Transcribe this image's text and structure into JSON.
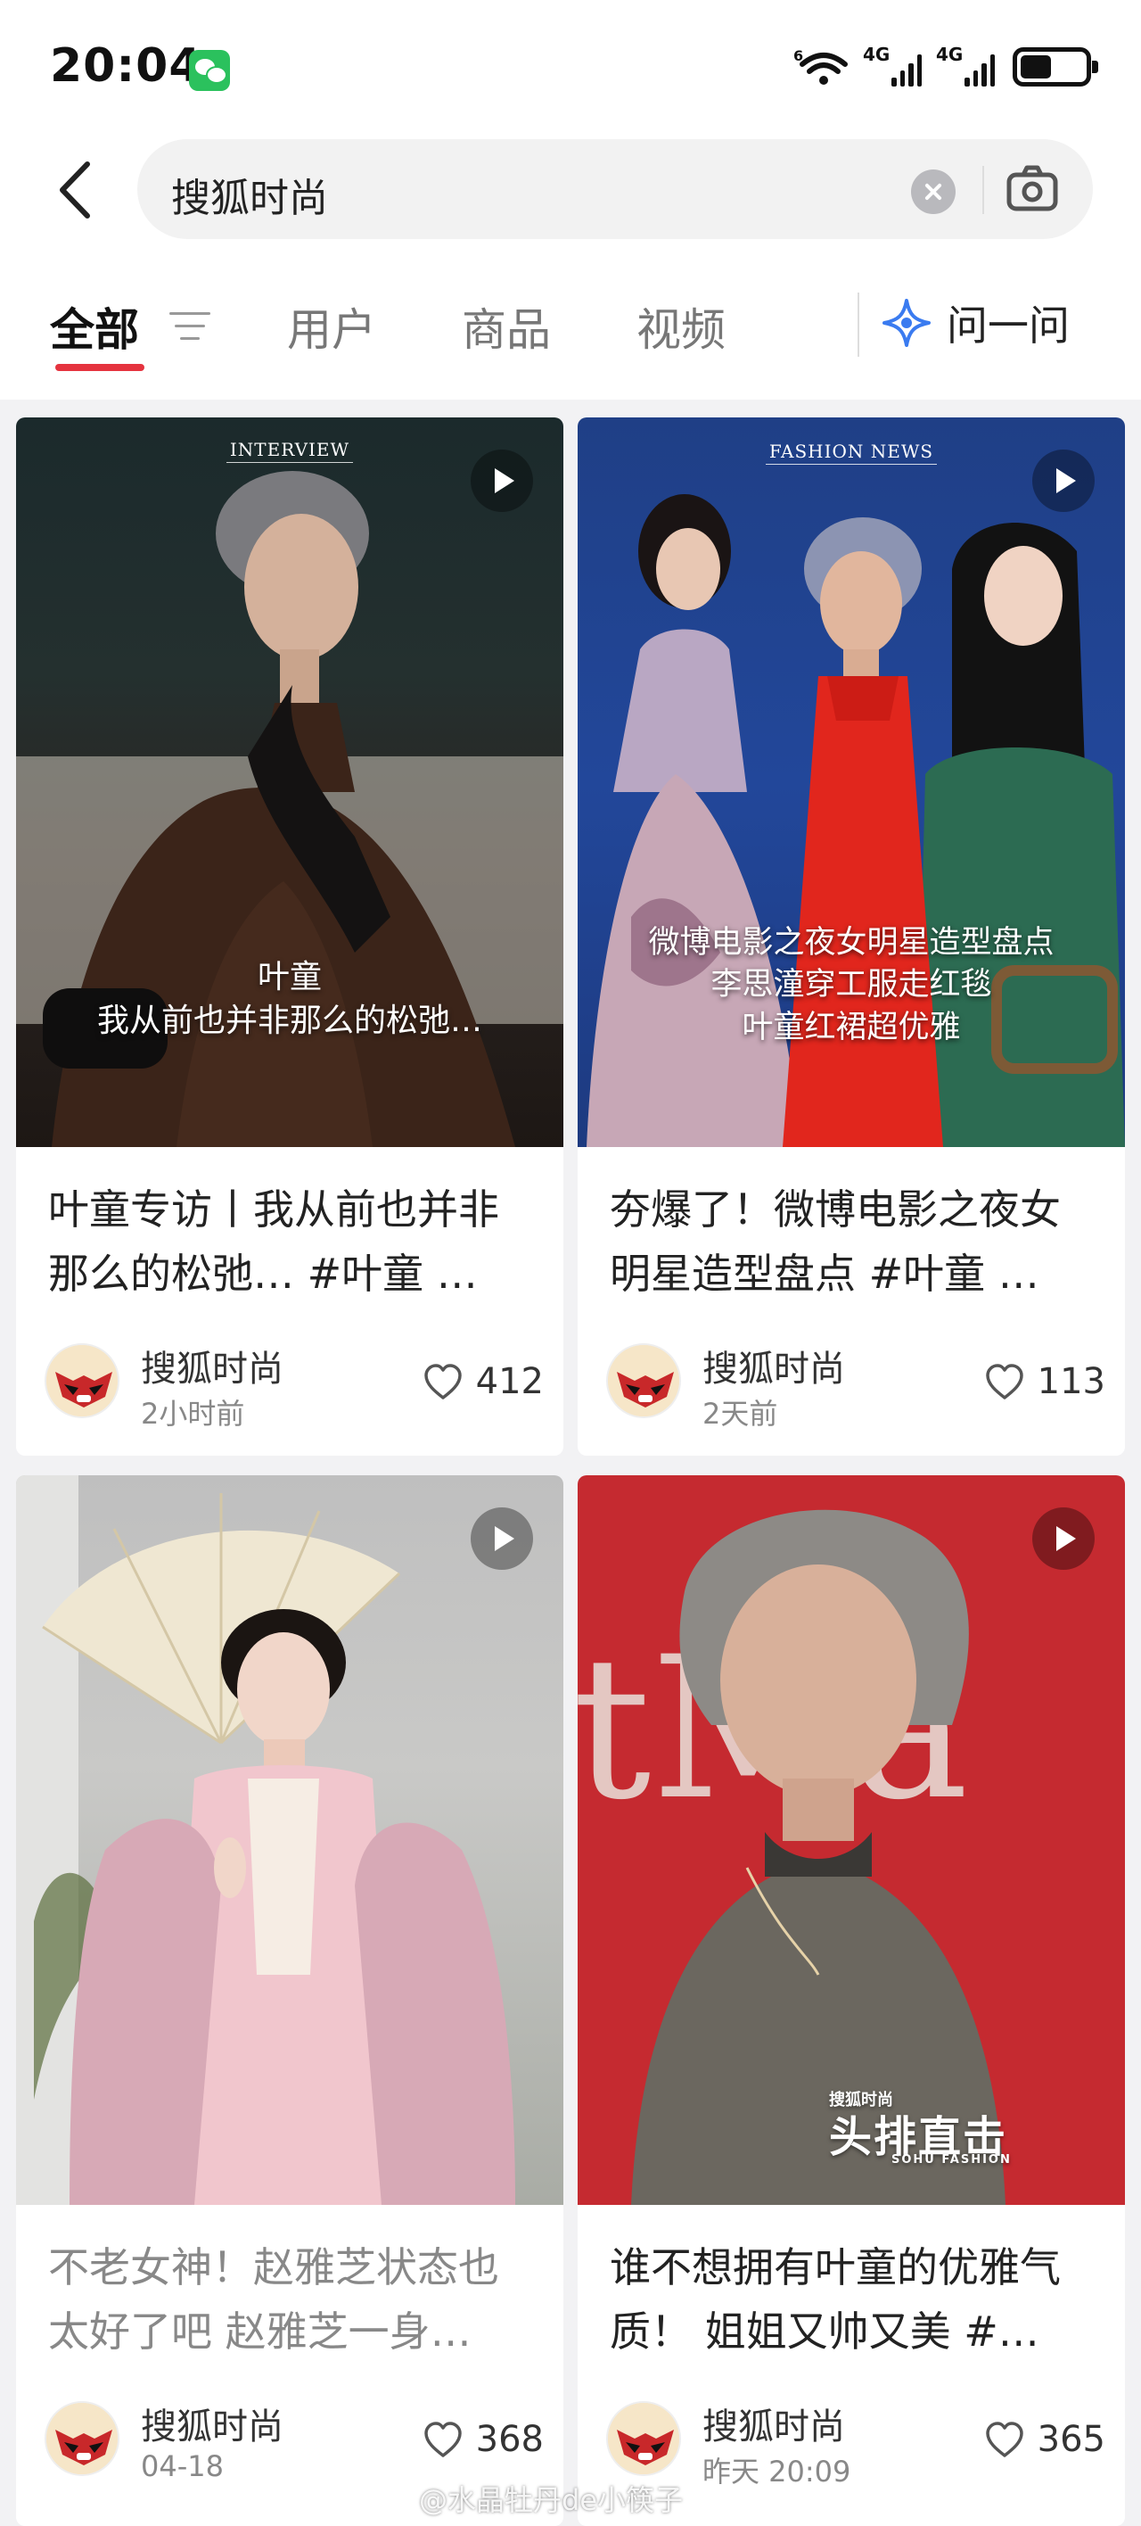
{
  "status_bar": {
    "time": "20:04",
    "network_1": "4G",
    "network_2": "4G",
    "wifi_badge": "6"
  },
  "search": {
    "query": "搜狐时尚"
  },
  "tabs": [
    {
      "label": "全部",
      "active": true
    },
    {
      "label": "用户"
    },
    {
      "label": "商品"
    },
    {
      "label": "视频"
    }
  ],
  "ask_label": "问一问",
  "accent_color": "#e5333f",
  "cards": [
    {
      "thumb_label": "INTERVIEW",
      "overlay_lines": [
        "叶童",
        "我从前也并非那么的松弛…"
      ],
      "title": "叶童专访丨我从前也并非那么的松弛… #叶童 …",
      "author": "搜狐时尚",
      "time": "2小时前",
      "likes": "412"
    },
    {
      "thumb_label": "FASHION NEWS",
      "overlay_lines": [
        "微博电影之夜女明星造型盘点",
        "李思潼穿工服走红毯",
        "叶童红裙超优雅"
      ],
      "title": "夯爆了！微博电影之夜女明星造型盘点 #叶童 …",
      "author": "搜狐时尚",
      "time": "2天前",
      "likes": "113"
    },
    {
      "title": "不老女神！赵雅芝状态也太好了吧 赵雅芝一身…",
      "author": "搜狐时尚",
      "time": "04-18",
      "likes": "368"
    },
    {
      "thumb_brand": {
        "small": "搜狐时尚",
        "big": "头排直击",
        "sub": "SOHU FASHION"
      },
      "backdrop_text": "tMa",
      "title": "谁不想拥有叶童的优雅气质！ 姐姐又帅又美 #…",
      "author": "搜狐时尚",
      "time": "昨天 20:09",
      "likes": "365"
    }
  ],
  "watermark": "@水晶牡丹de小筷子"
}
